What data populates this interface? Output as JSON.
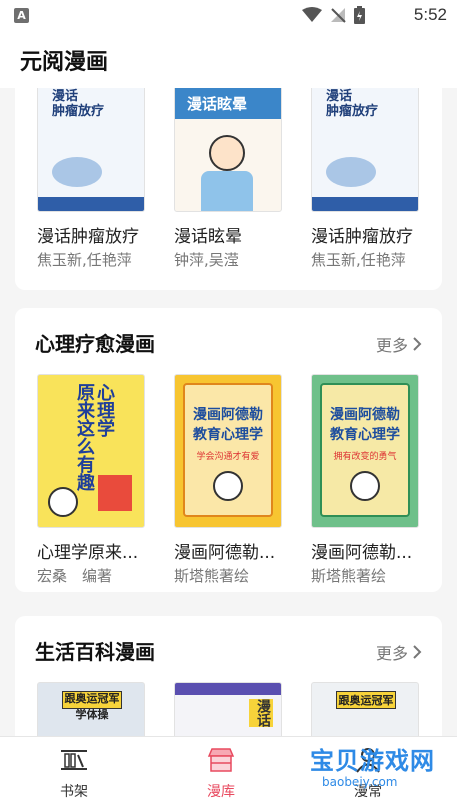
{
  "status_bar": {
    "time": "5:52",
    "notification_letter": "A"
  },
  "app_bar": {
    "title": "元阅漫画"
  },
  "sections": [
    {
      "title": "",
      "books": [
        {
          "title": "漫话肿瘤放疗",
          "author": "焦玉新,任艳萍",
          "cover_title": "漫话\n肿瘤放疗"
        },
        {
          "title": "漫话眩晕",
          "author": "钟萍,吴滢",
          "cover_title": "漫话眩晕"
        },
        {
          "title": "漫话肿瘤放疗",
          "author": "焦玉新,任艳萍",
          "cover_title": "漫话\n肿瘤放疗"
        }
      ]
    },
    {
      "title": "心理疗愈漫画",
      "more_label": "更多",
      "books": [
        {
          "title": "心理学原来...",
          "author": "宏桑　编著",
          "cover_title": "心理学\n原来这么有趣"
        },
        {
          "title": "漫画阿德勒...",
          "author": "斯塔熊著绘",
          "cover_title": "漫画阿德勒\n教育心理学",
          "cover_sub": "学会沟通才有爱"
        },
        {
          "title": "漫画阿德勒...",
          "author": "斯塔熊著绘",
          "cover_title": "漫画阿德勒\n教育心理学",
          "cover_sub": "拥有改变的勇气"
        }
      ]
    },
    {
      "title": "生活百科漫画",
      "more_label": "更多",
      "books": [
        {
          "cover_title": "跟奥运冠军\n学体操"
        },
        {
          "cover_title": "漫话"
        },
        {
          "cover_title": "跟奥运冠军"
        }
      ]
    }
  ],
  "nav": [
    {
      "label": "书架",
      "icon": "bookshelf-icon"
    },
    {
      "label": "漫库",
      "icon": "store-icon",
      "active": true
    },
    {
      "label": "漫常",
      "icon": "user-icon"
    }
  ],
  "watermark": {
    "text": "宝贝游戏网",
    "sub": "baobeiy.com"
  },
  "colors": {
    "accent": "#e84a5f",
    "background": "#f5f5f5"
  }
}
